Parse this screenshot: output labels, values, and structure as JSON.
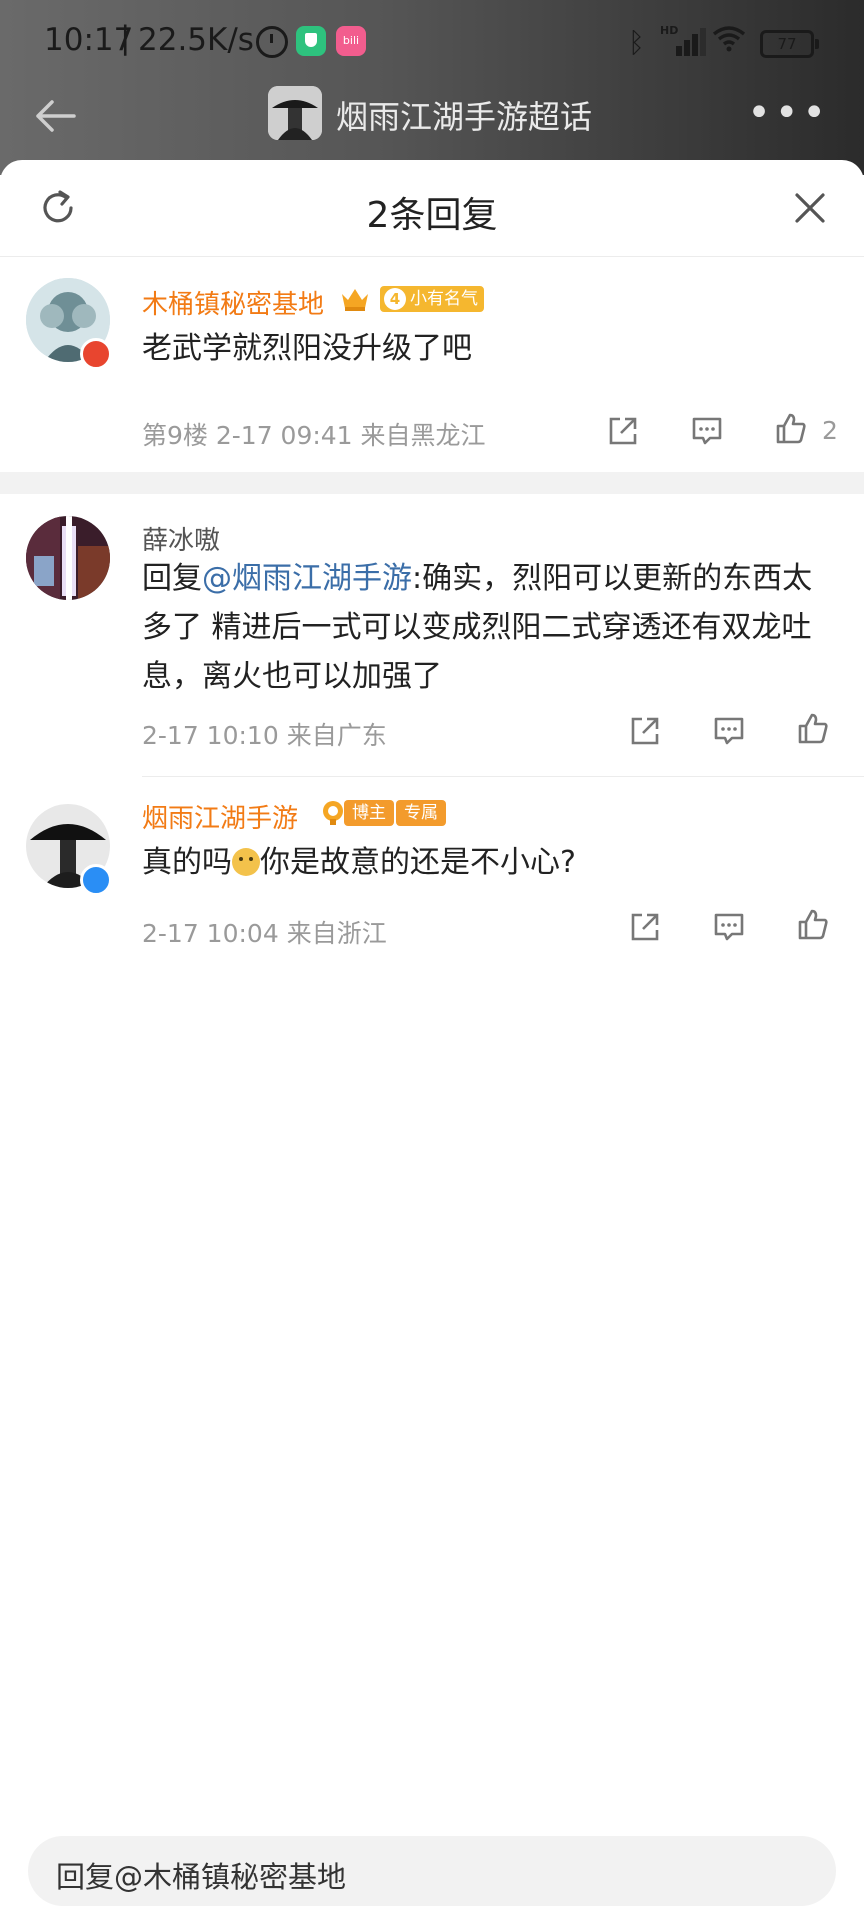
{
  "status_bar": {
    "time": "10:17",
    "separator": "|",
    "net_speed": "22.5K/s",
    "app2_label": "bili",
    "bluetooth_icon": "bluetooth-icon",
    "signal_label": "HD",
    "wifi_icon": "wifi-icon",
    "battery": "77"
  },
  "nav": {
    "title": "烟雨江湖手游超话",
    "more": "•••"
  },
  "panel": {
    "title": "2条回复"
  },
  "comments": [
    {
      "name": "木桶镇秘密基地",
      "level": "4",
      "level_label": "小有名气",
      "text": "老武学就烈阳没升级了吧",
      "floor": "第9楼",
      "datetime": "2-17 09:41",
      "location": "来自黑龙江",
      "likes": "2"
    },
    {
      "name": "薛冰嗷",
      "reply_prefix": "回复",
      "mention": "@烟雨江湖手游",
      "text": ":确实，烈阳可以更新的东西太多了 精进后一式可以变成烈阳二式穿透还有双龙吐息，离火也可以加强了",
      "datetime": "2-17 10:10",
      "location": "来自广东"
    },
    {
      "name": "烟雨江湖手游",
      "tag_blogger": "博主",
      "tag_exclusive": "专属",
      "text_before_emoji": "真的吗",
      "text_after_emoji": "你是故意的还是不小心?",
      "datetime": "2-17 10:04",
      "location": "来自浙江"
    }
  ],
  "reply_box": {
    "placeholder": "回复@木桶镇秘密基地"
  },
  "colors": {
    "accent_orange": "#f27b15",
    "mention_blue": "#3b6ea8",
    "meta_gray": "#9a9a9a"
  }
}
